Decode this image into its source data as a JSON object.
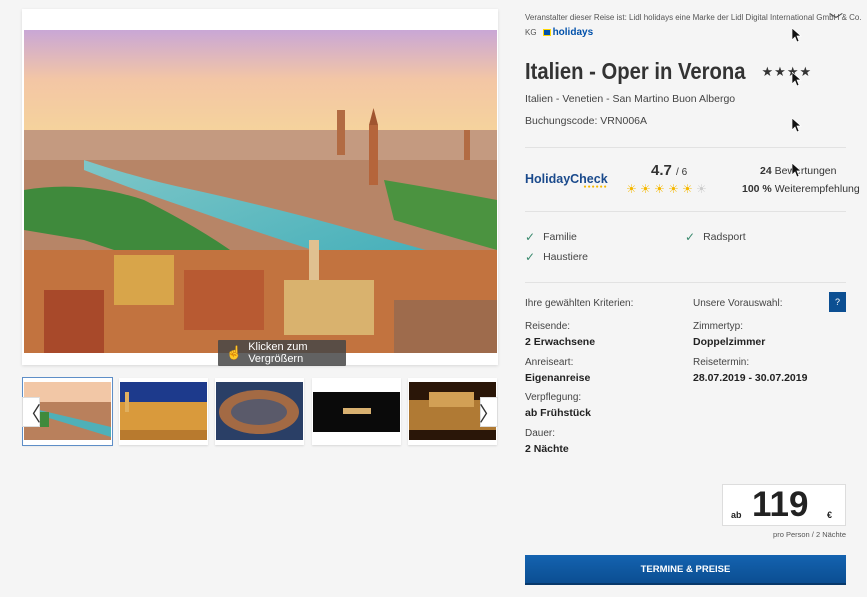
{
  "gallery": {
    "zoom_hint": "Klicken zum Vergrößern",
    "prev_icon": "chevron-left-icon",
    "next_icon": "chevron-right-icon",
    "thumbnails": [
      "Verona Panorama",
      "Arena bei Nacht",
      "Arena von oben",
      "Opernbühne",
      "Opernaufführung"
    ]
  },
  "header": {
    "operator": "Veranstalter dieser Reise ist: Lidl holidays eine Marke der Lidl Digital International GmbH & Co.",
    "operator_kg": "KG",
    "brand_logo": "holidays"
  },
  "product": {
    "title": "Italien - Oper in Verona",
    "star_rating": "★★★★",
    "location": "Italien - Venetien - San Martino Buon Albergo",
    "booking_code": "Buchungscode: VRN006A"
  },
  "rating": {
    "provider": "HolidayCheck",
    "score": "4.7",
    "score_max": "/ 6",
    "suns_filled": 5,
    "suns_total": 6,
    "review_count": "24",
    "review_label": "Bewertungen",
    "recommend_pct": "100 %",
    "recommend_label": "Weiterempfehlung"
  },
  "features": [
    "Familie",
    "Radsport",
    "Haustiere"
  ],
  "criteria": {
    "left_heading": "Ihre gewählten Kriterien:",
    "right_heading": "Unsere Vorauswahl:",
    "help": "?",
    "travelers_label": "Reisende:",
    "travelers_value": "2 Erwachsene",
    "arrival_label": "Anreiseart:",
    "arrival_value": "Eigenanreise",
    "board_label": "Verpflegung:",
    "board_value": "ab Frühstück",
    "duration_label": "Dauer:",
    "duration_value": "2 Nächte",
    "room_label": "Zimmertyp:",
    "room_value": "Doppelzimmer",
    "dates_label": "Reisetermin:",
    "dates_value": "28.07.2019 - 30.07.2019"
  },
  "price": {
    "prefix": "ab",
    "amount": "119",
    "currency": "€",
    "note": "pro Person / 2 Nächte"
  },
  "cta": {
    "label": "TERMINE & PREISE"
  }
}
